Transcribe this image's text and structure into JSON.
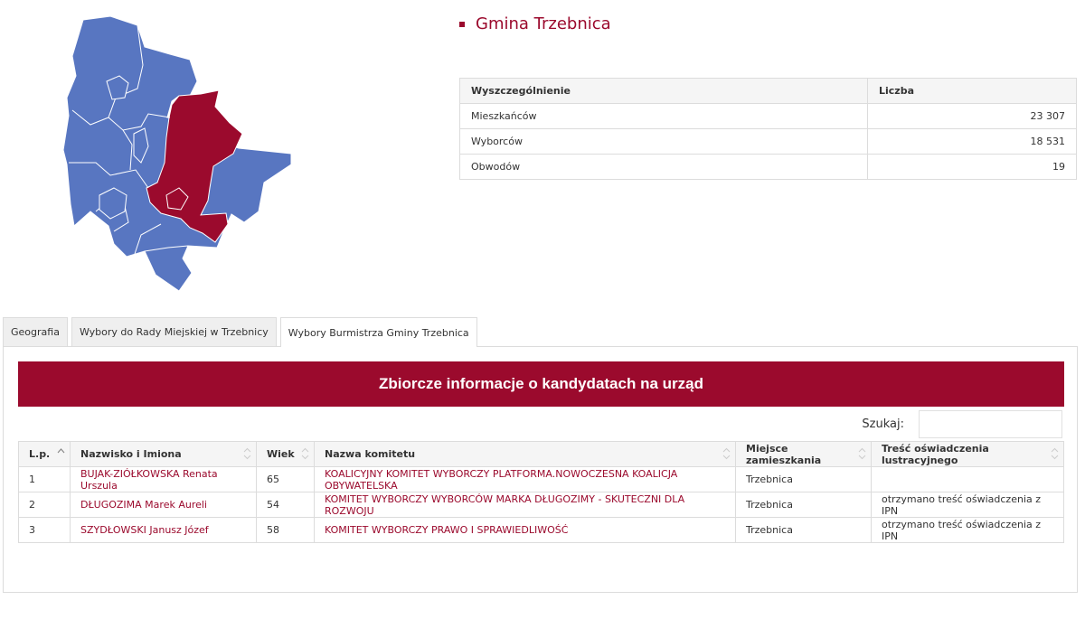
{
  "gmina": {
    "title": "Gmina Trzebnica"
  },
  "map": {
    "base_color": "#5876c1",
    "highlight_color": "#9b0a2d",
    "border_color": "#ffffff"
  },
  "stats": {
    "headers": [
      "Wyszczególnienie",
      "Liczba"
    ],
    "rows": [
      {
        "label": "Mieszkańców",
        "value": "23 307"
      },
      {
        "label": "Wyborców",
        "value": "18 531"
      },
      {
        "label": "Obwodów",
        "value": "19"
      }
    ]
  },
  "tabs": [
    {
      "label": "Geografia",
      "active": false
    },
    {
      "label": "Wybory do Rady Miejskiej w Trzebnicy",
      "active": false
    },
    {
      "label": "Wybory Burmistrza Gminy Trzebnica",
      "active": true
    }
  ],
  "candidates_section": {
    "banner": "Zbiorcze informacje o kandydatach na urząd",
    "search_label": "Szukaj:",
    "search_value": "",
    "headers": [
      "L.p.",
      "Nazwisko i Imiona",
      "Wiek",
      "Nazwa komitetu",
      "Miejsce zamieszkania",
      "Treść oświadczenia lustracyjnego"
    ],
    "rows": [
      {
        "lp": "1",
        "name": "BUJAK-ZIÓŁKOWSKA Renata Urszula",
        "age": "65",
        "committee": "KOALICYJNY KOMITET WYBORCZY PLATFORMA.NOWOCZESNA KOALICJA OBYWATELSKA",
        "residence": "Trzebnica",
        "statement": ""
      },
      {
        "lp": "2",
        "name": "DŁUGOZIMA Marek Aureli",
        "age": "54",
        "committee": "KOMITET WYBORCZY WYBORCÓW MARKA DŁUGOZIMY - SKUTECZNI DLA ROZWOJU",
        "residence": "Trzebnica",
        "statement": "otrzymano treść oświadczenia z IPN"
      },
      {
        "lp": "3",
        "name": "SZYDŁOWSKI Janusz Józef",
        "age": "58",
        "committee": "KOMITET WYBORCZY PRAWO I SPRAWIEDLIWOŚĆ",
        "residence": "Trzebnica",
        "statement": "otrzymano treść oświadczenia z IPN"
      }
    ]
  }
}
